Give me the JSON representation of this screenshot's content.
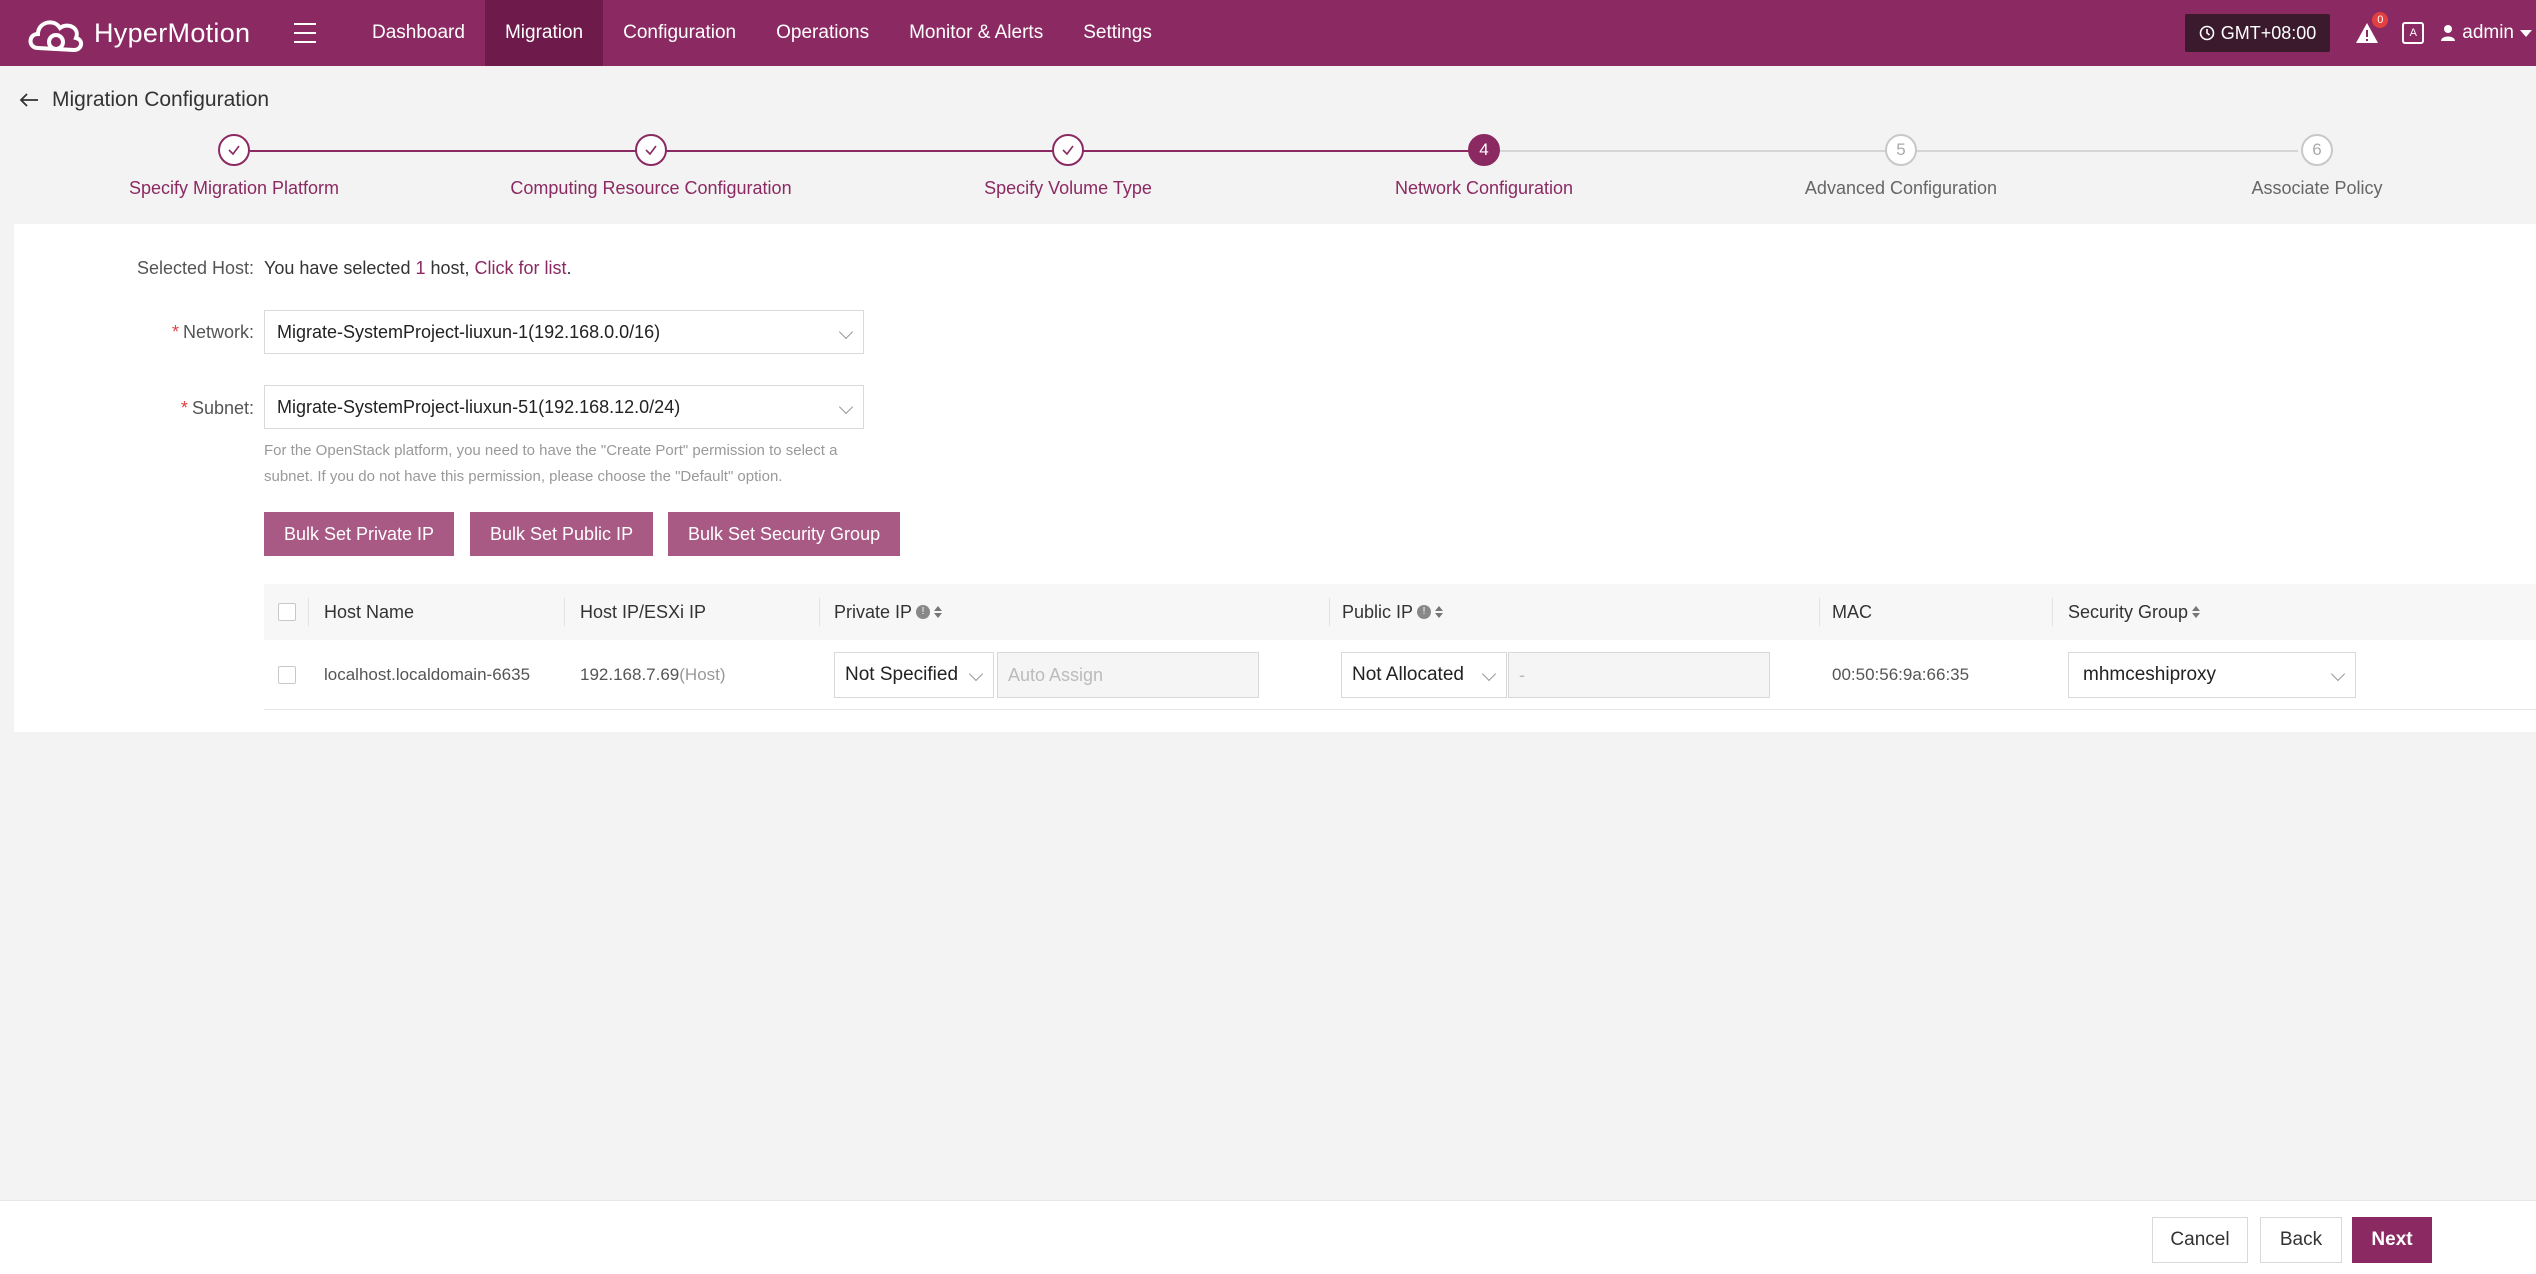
{
  "app": {
    "name": "HyperMotion"
  },
  "nav": {
    "items": [
      {
        "label": "Dashboard"
      },
      {
        "label": "Migration"
      },
      {
        "label": "Configuration"
      },
      {
        "label": "Operations"
      },
      {
        "label": "Monitor & Alerts"
      },
      {
        "label": "Settings"
      }
    ],
    "active": "Migration"
  },
  "topbar": {
    "timezone": "GMT+08:00",
    "alert_count": "0",
    "lang_icon": "A",
    "user": "admin"
  },
  "page": {
    "title": "Migration Configuration"
  },
  "steps": [
    {
      "label": "Specify Migration Platform",
      "state": "done",
      "num": ""
    },
    {
      "label": "Computing Resource Configuration",
      "state": "done",
      "num": ""
    },
    {
      "label": "Specify Volume Type",
      "state": "done",
      "num": ""
    },
    {
      "label": "Network Configuration",
      "state": "active",
      "num": "4"
    },
    {
      "label": "Advanced Configuration",
      "state": "todo",
      "num": "5"
    },
    {
      "label": "Associate Policy",
      "state": "todo",
      "num": "6"
    }
  ],
  "form": {
    "selected_host_label": "Selected Host:",
    "selected_host_pre": "You have selected ",
    "selected_host_count": "1",
    "selected_host_mid": " host, ",
    "selected_host_link": "Click for list",
    "selected_host_end": ".",
    "network_label": "Network:",
    "network_value": "Migrate-SystemProject-liuxun-1(192.168.0.0/16)",
    "subnet_label": "Subnet:",
    "subnet_value": "Migrate-SystemProject-liuxun-51(192.168.12.0/24)",
    "hint": "For the OpenStack platform, you need to have the \"Create Port\" permission to select a subnet. If you do not have this permission, please choose the \"Default\" option.",
    "btn_private_ip": "Bulk Set Private IP",
    "btn_public_ip": "Bulk Set Public IP",
    "btn_security_group": "Bulk Set Security Group"
  },
  "table": {
    "columns": {
      "host_name": "Host Name",
      "host_ip": "Host IP/ESXi IP",
      "private_ip": "Private IP",
      "public_ip": "Public IP",
      "mac": "MAC",
      "security_group": "Security Group"
    },
    "rows": [
      {
        "host_name": "localhost.localdomain-6635",
        "host_ip": "192.168.7.69",
        "host_ip_suffix": "(Host)",
        "private_ip_mode": "Not Specified",
        "private_ip_placeholder": "Auto Assign",
        "public_ip_mode": "Not Allocated",
        "public_ip_value": "-",
        "mac": "00:50:56:9a:66:35",
        "security_group": "mhmceshiproxy"
      }
    ]
  },
  "footer": {
    "cancel": "Cancel",
    "back": "Back",
    "next": "Next"
  },
  "colors": {
    "brand": "#8b2a62",
    "brand_dark": "#6e1a4a",
    "button_light": "#a85a84"
  }
}
